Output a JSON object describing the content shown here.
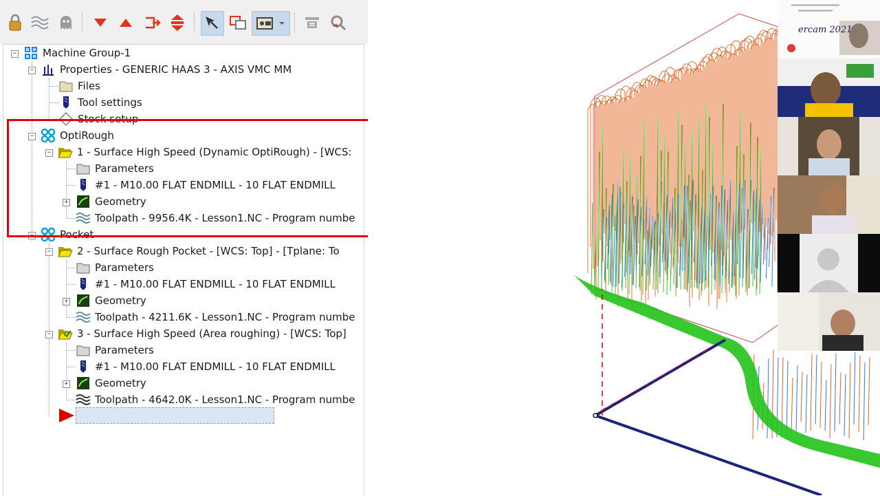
{
  "toolbar": {
    "buttons": [
      {
        "icon": "lock-icon"
      },
      {
        "icon": "toolpath-wave-icon"
      },
      {
        "icon": "ghost-icon"
      },
      {
        "icon": "move-down-icon"
      },
      {
        "icon": "move-up-icon"
      },
      {
        "icon": "insert-arrow-icon"
      },
      {
        "icon": "scroll-updown-icon"
      },
      {
        "icon": "select-cursor-icon"
      },
      {
        "icon": "window-toggle-icon"
      },
      {
        "icon": "display-options-icon"
      },
      {
        "icon": "post-process-icon"
      },
      {
        "icon": "verify-icon"
      }
    ]
  },
  "tree": {
    "machine_group": "Machine Group-1",
    "properties": "Properties - GENERIC HAAS 3 - AXIS VMC MM",
    "files": "Files",
    "tool_settings": "Tool settings",
    "stock_setup": "Stock setup",
    "groups": [
      {
        "name": "OptiRough",
        "operations": [
          {
            "label": "1 - Surface High Speed (Dynamic OptiRough) - [WCS:",
            "parameters": "Parameters",
            "tool": "#1 - M10.00 FLAT ENDMILL - 10 FLAT ENDMILL",
            "geometry": "Geometry",
            "toolpath": "Toolpath - 9956.4K - Lesson1.NC - Program numbe"
          }
        ]
      },
      {
        "name": "Pocket",
        "operations": [
          {
            "label": "2 - Surface Rough Pocket - [WCS: Top] - [Tplane: To",
            "parameters": "Parameters",
            "tool": "#1 - M10.00 FLAT ENDMILL - 10 FLAT ENDMILL",
            "geometry": "Geometry",
            "toolpath": "Toolpath - 4211.6K - Lesson1.NC - Program numbe"
          },
          {
            "label": "3 - Surface High Speed (Area roughing) - [WCS: Top]",
            "parameters": "Parameters",
            "tool": "#1 - M10.00 FLAT ENDMILL - 10 FLAT ENDMILL",
            "geometry": "Geometry",
            "toolpath": "Toolpath - 4642.0K - Lesson1.NC - Program numbe"
          }
        ]
      }
    ]
  },
  "video_call": {
    "slide_text": "ercam 2021",
    "participants": [
      "participant-1",
      "participant-2",
      "participant-3",
      "participant-4",
      "participant-5",
      "participant-6"
    ]
  },
  "colors": {
    "highlight": "#e00000",
    "toolpath_orange": "#e0611c",
    "toolpath_green": "#22c21a",
    "toolpath_blue": "#2a7de1",
    "axis_navy": "#1a237e"
  }
}
